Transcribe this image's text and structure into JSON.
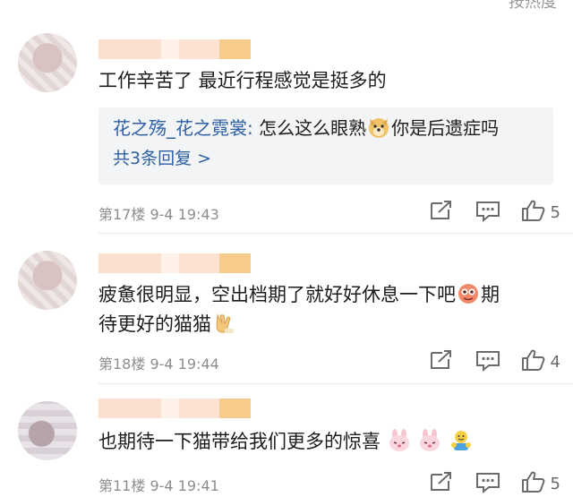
{
  "header": {
    "sort_label": "按热度"
  },
  "comments": [
    {
      "text": "工作辛苦了 最近行程感觉是挺多的",
      "reply": {
        "user": "花之殇_花之霓裳:",
        "text_before": "怎么这么眼熟",
        "emoji": "doge-emoji",
        "text_after": "你是后遗症吗",
        "more": "共3条回复 >"
      },
      "floor": "第17楼",
      "time": "9-4 19:43",
      "likes": "5"
    },
    {
      "text_line1_before": "疲惫很明显，空出档期了就好好休息一下吧",
      "emoji1": "monster-emoji",
      "text_line1_after": "期",
      "text_line2": "待更好的猫猫",
      "emoji2": "hand-gesture-emoji",
      "floor": "第18楼",
      "time": "9-4 19:44",
      "likes": "4"
    },
    {
      "text": "也期待一下猫带给我们更多的惊喜",
      "emojis": [
        "bunny-emoji",
        "bunny-emoji",
        "hug-emoji"
      ],
      "floor": "第11楼",
      "time": "9-4 19:41",
      "likes": "5"
    }
  ],
  "colors": {
    "link": "#2d5fa5",
    "meta": "#8d8d8d",
    "reply_bg": "#f3f4f6"
  }
}
